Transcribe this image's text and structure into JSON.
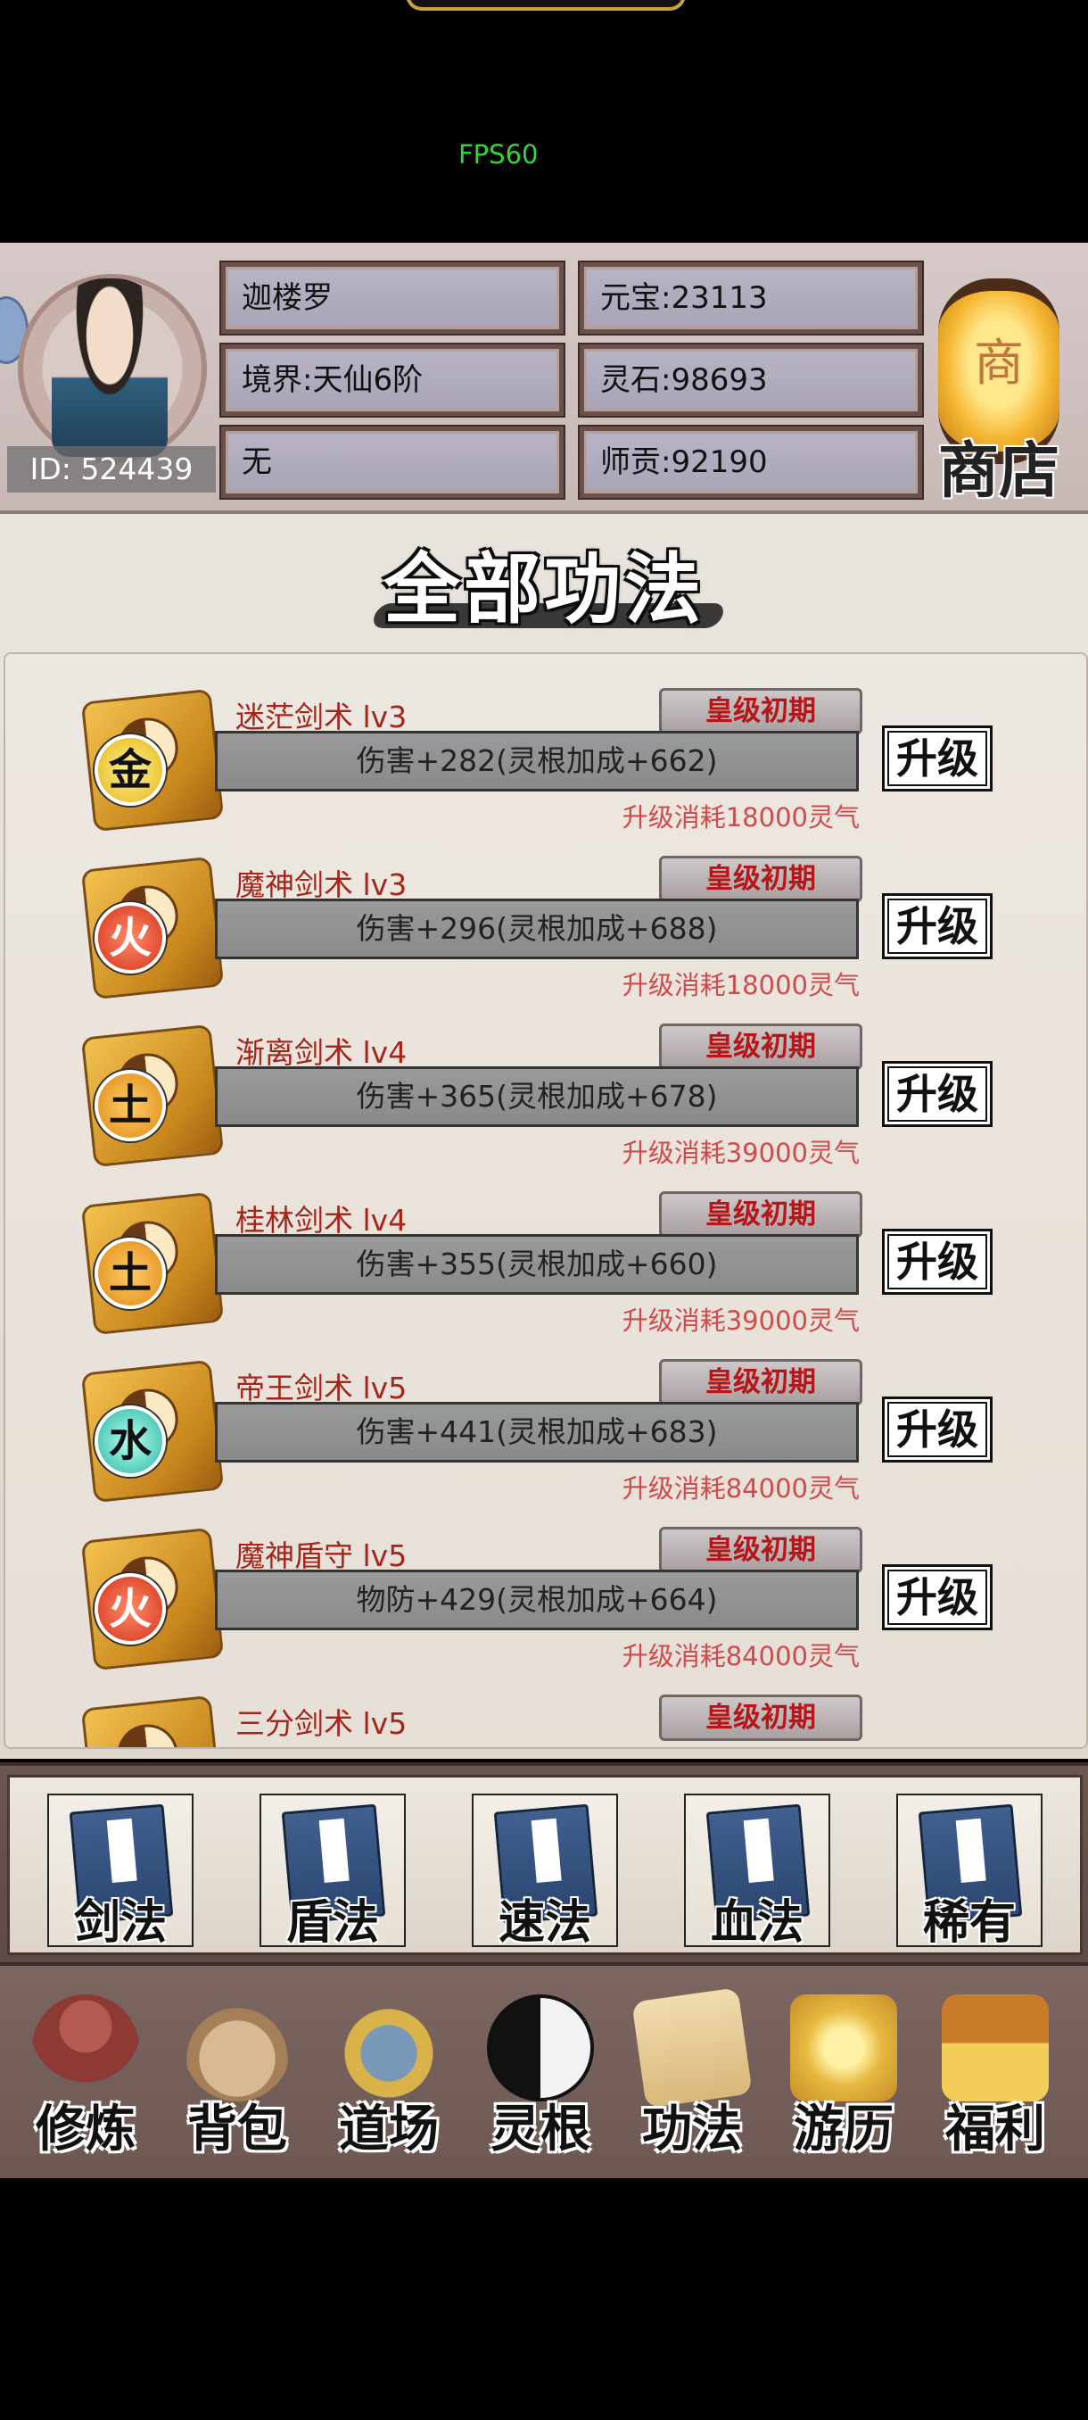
{
  "status": {
    "fps": "FPS60"
  },
  "header": {
    "player_id": "ID: 524439",
    "name": "迦楼罗",
    "realm": "境界:天仙6阶",
    "sect": "无",
    "yuanbao": "元宝:23113",
    "lingshi": "灵石:98693",
    "shigong": "师贡:92190",
    "shop_label": "商店",
    "lantern_glyph": "商"
  },
  "page": {
    "title": "全部功法"
  },
  "skills": [
    {
      "name": "迷茫剑术 lv3",
      "rank": "皇级初期",
      "stat": "伤害+282(灵根加成+662)",
      "cost": "升级消耗18000灵气",
      "element": "金",
      "button": "升级"
    },
    {
      "name": "魔神剑术 lv3",
      "rank": "皇级初期",
      "stat": "伤害+296(灵根加成+688)",
      "cost": "升级消耗18000灵气",
      "element": "火",
      "button": "升级"
    },
    {
      "name": "渐离剑术 lv4",
      "rank": "皇级初期",
      "stat": "伤害+365(灵根加成+678)",
      "cost": "升级消耗39000灵气",
      "element": "土",
      "button": "升级"
    },
    {
      "name": "桂林剑术 lv4",
      "rank": "皇级初期",
      "stat": "伤害+355(灵根加成+660)",
      "cost": "升级消耗39000灵气",
      "element": "土",
      "button": "升级"
    },
    {
      "name": "帝王剑术 lv5",
      "rank": "皇级初期",
      "stat": "伤害+441(灵根加成+683)",
      "cost": "升级消耗84000灵气",
      "element": "水",
      "button": "升级"
    },
    {
      "name": "魔神盾守 lv5",
      "rank": "皇级初期",
      "stat": "物防+429(灵根加成+664)",
      "cost": "升级消耗84000灵气",
      "element": "火",
      "button": "升级"
    },
    {
      "name": "三分剑术 lv5",
      "rank": "皇级初期"
    }
  ],
  "category_tabs": [
    "剑法",
    "盾法",
    "速法",
    "血法",
    "稀有"
  ],
  "bottom_nav": [
    "修炼",
    "背包",
    "道场",
    "灵根",
    "功法",
    "游历",
    "福利"
  ]
}
